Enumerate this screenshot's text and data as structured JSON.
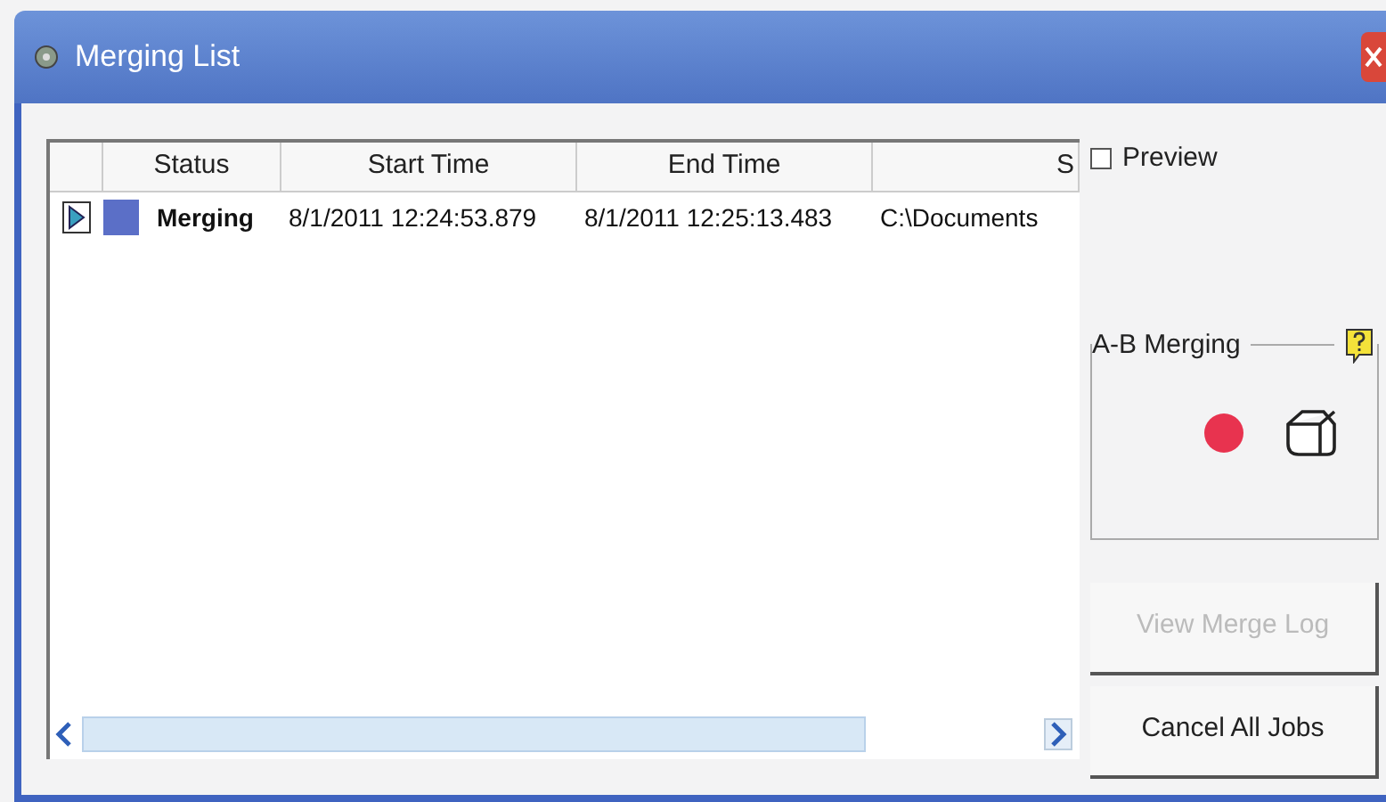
{
  "window": {
    "title": "Merging List"
  },
  "table": {
    "columns": [
      "Status",
      "Start Time",
      "End Time",
      "S"
    ],
    "rows": [
      {
        "cells": [
          "Merging",
          "8/1/2011 12:24:53.879",
          "8/1/2011 12:25:13.483",
          "C:\\Documents"
        ]
      }
    ]
  },
  "preview": {
    "label": "Preview",
    "checked": false
  },
  "group": {
    "title": "A-B Merging"
  },
  "buttons": [
    {
      "label": "View Merge Log",
      "disabled": true
    },
    {
      "label": "Cancel All Jobs",
      "disabled": false
    }
  ]
}
